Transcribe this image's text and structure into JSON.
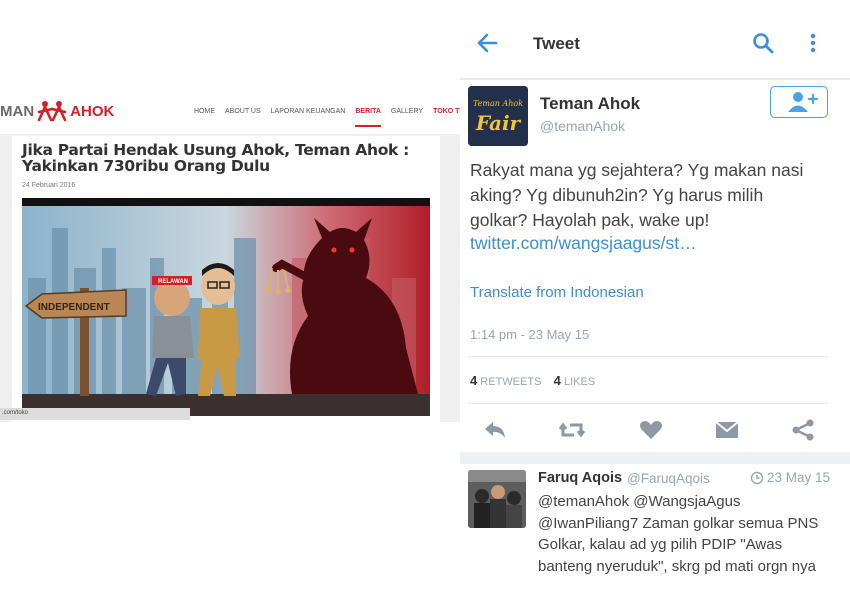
{
  "website": {
    "logo": {
      "left_text": "MAN",
      "right_text": "AHOK"
    },
    "nav": [
      {
        "label": "HOME"
      },
      {
        "label": "ABOUT US"
      },
      {
        "label": "LAPORAN KEUANGAN"
      },
      {
        "label": "BERITA"
      },
      {
        "label": "GALLERY"
      },
      {
        "label": "TOKO TEMAN A"
      }
    ],
    "article": {
      "title": "Jika Partai Hendak Usung Ahok, Teman Ahok : Yakinkan 730ribu Orang Dulu",
      "date": "24 Februari 2016",
      "cartoon": {
        "signpost": "INDEPENDENT",
        "headband": "RELAWAN"
      }
    },
    "status_url": ".com/toko"
  },
  "twitter": {
    "topbar": {
      "title": "Tweet",
      "icons": [
        "back-arrow-icon",
        "search-icon",
        "more-vertical-icon"
      ]
    },
    "tweet": {
      "author_name": "Teman Ahok",
      "author_handle": "@temanAhok",
      "avatar_text_top": "Teman Ahok",
      "avatar_text_bottom": "Fair",
      "text": "Rakyat mana yg sejahtera? Yg makan nasi aking? Yg dibunuh2in? Yg harus milih golkar? Hayolah pak, wake up!",
      "link": "twitter.com/wangsjaagus/st…",
      "translate": "Translate from Indonesian",
      "timestamp": "1:14 pm - 23 May 15",
      "retweets_count": "4",
      "retweets_label": "RETWEETS",
      "likes_count": "4",
      "likes_label": "LIKES"
    },
    "actions": [
      "reply-icon",
      "retweet-icon",
      "like-icon",
      "direct-message-icon",
      "share-icon"
    ],
    "reply": {
      "name": "Faruq Aqois",
      "handle": "@FaruqAqois",
      "time": "23 May 15",
      "text": "@temanAhok @WangsjaAgus @IwanPiliang7 Zaman golkar semua PNS Golkar, kalau ad yg pilih PDIP \"Awas banteng nyeruduk\", skrg pd mati orgn nya"
    }
  },
  "colors": {
    "brand_red": "#d32027",
    "twitter_blue": "#3b8ed8",
    "muted_gray": "#9aa5ad"
  }
}
